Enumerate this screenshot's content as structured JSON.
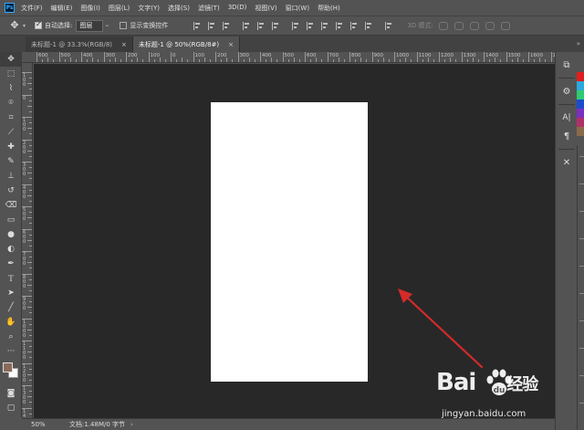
{
  "app": {
    "logo_text": "Ps",
    "menus": [
      "文件(F)",
      "编辑(E)",
      "图像(I)",
      "图层(L)",
      "文字(Y)",
      "选择(S)",
      "滤镜(T)",
      "3D(D)",
      "视图(V)",
      "窗口(W)",
      "帮助(H)"
    ]
  },
  "options_bar": {
    "auto_select_label": "自动选择:",
    "auto_select_checked": true,
    "auto_select_target": "图层",
    "show_transform_label": "显示变换控件",
    "show_transform_checked": false,
    "mode_3d_label": "3D 模式:"
  },
  "tabs": [
    {
      "title": "未标题-1 @ 33.3%(RGB/8)",
      "close": "×",
      "active": false
    },
    {
      "title": "未标题-1 @ 50%(RGB/8#)",
      "close": "×",
      "active": true
    }
  ],
  "rulers": {
    "horizontal": [
      "600",
      "500",
      "400",
      "300",
      "200",
      "100",
      "0",
      "100",
      "200",
      "300",
      "400",
      "500",
      "600",
      "700",
      "800",
      "900",
      "1000",
      "1100",
      "1200",
      "1300",
      "1400",
      "1500",
      "1600",
      "1700"
    ],
    "vertical": [
      "100",
      "0",
      "100",
      "200",
      "300",
      "400",
      "500",
      "600",
      "700",
      "800",
      "900",
      "1000",
      "1100",
      "1200",
      "1300",
      "1400"
    ]
  },
  "tools": [
    {
      "name": "move-tool",
      "glyph": "✥"
    },
    {
      "name": "marquee-tool",
      "glyph": "⬚"
    },
    {
      "name": "lasso-tool",
      "glyph": "⌇"
    },
    {
      "name": "quick-select-tool",
      "glyph": "⌾"
    },
    {
      "name": "crop-tool",
      "glyph": "⌗"
    },
    {
      "name": "eyedropper-tool",
      "glyph": "⟋"
    },
    {
      "name": "healing-brush-tool",
      "glyph": "✚"
    },
    {
      "name": "brush-tool",
      "glyph": "✎"
    },
    {
      "name": "clone-stamp-tool",
      "glyph": "⊥"
    },
    {
      "name": "history-brush-tool",
      "glyph": "↺"
    },
    {
      "name": "eraser-tool",
      "glyph": "⌫"
    },
    {
      "name": "gradient-tool",
      "glyph": "▭"
    },
    {
      "name": "blur-tool",
      "glyph": "●"
    },
    {
      "name": "dodge-tool",
      "glyph": "◐"
    },
    {
      "name": "pen-tool",
      "glyph": "✒"
    },
    {
      "name": "type-tool",
      "glyph": "T"
    },
    {
      "name": "path-select-tool",
      "glyph": "➤"
    },
    {
      "name": "line-tool",
      "glyph": "╱"
    },
    {
      "name": "hand-tool",
      "glyph": "✋"
    },
    {
      "name": "zoom-tool",
      "glyph": "⌕"
    },
    {
      "name": "more-tools",
      "glyph": "···"
    }
  ],
  "colors": {
    "foreground": "#8b6a5c",
    "background": "#ffffff",
    "arrow": "#d42a2a",
    "swatch_strip": [
      "#e01e1e",
      "#2aa9e0",
      "#2ecc71",
      "#1a4bd1",
      "#7b2fbf",
      "#b0306a",
      "#8a6a4a"
    ]
  },
  "status": {
    "zoom": "50%",
    "doc_info": "文档:1.48M/0 字节"
  },
  "dock": {
    "collapse": "»",
    "buttons": [
      "⧉",
      "⚙",
      "A|",
      "¶",
      "✕"
    ]
  },
  "watermark": {
    "logo": "Bai",
    "logo_suffix": "经验",
    "url": "jingyan.baidu.com"
  }
}
